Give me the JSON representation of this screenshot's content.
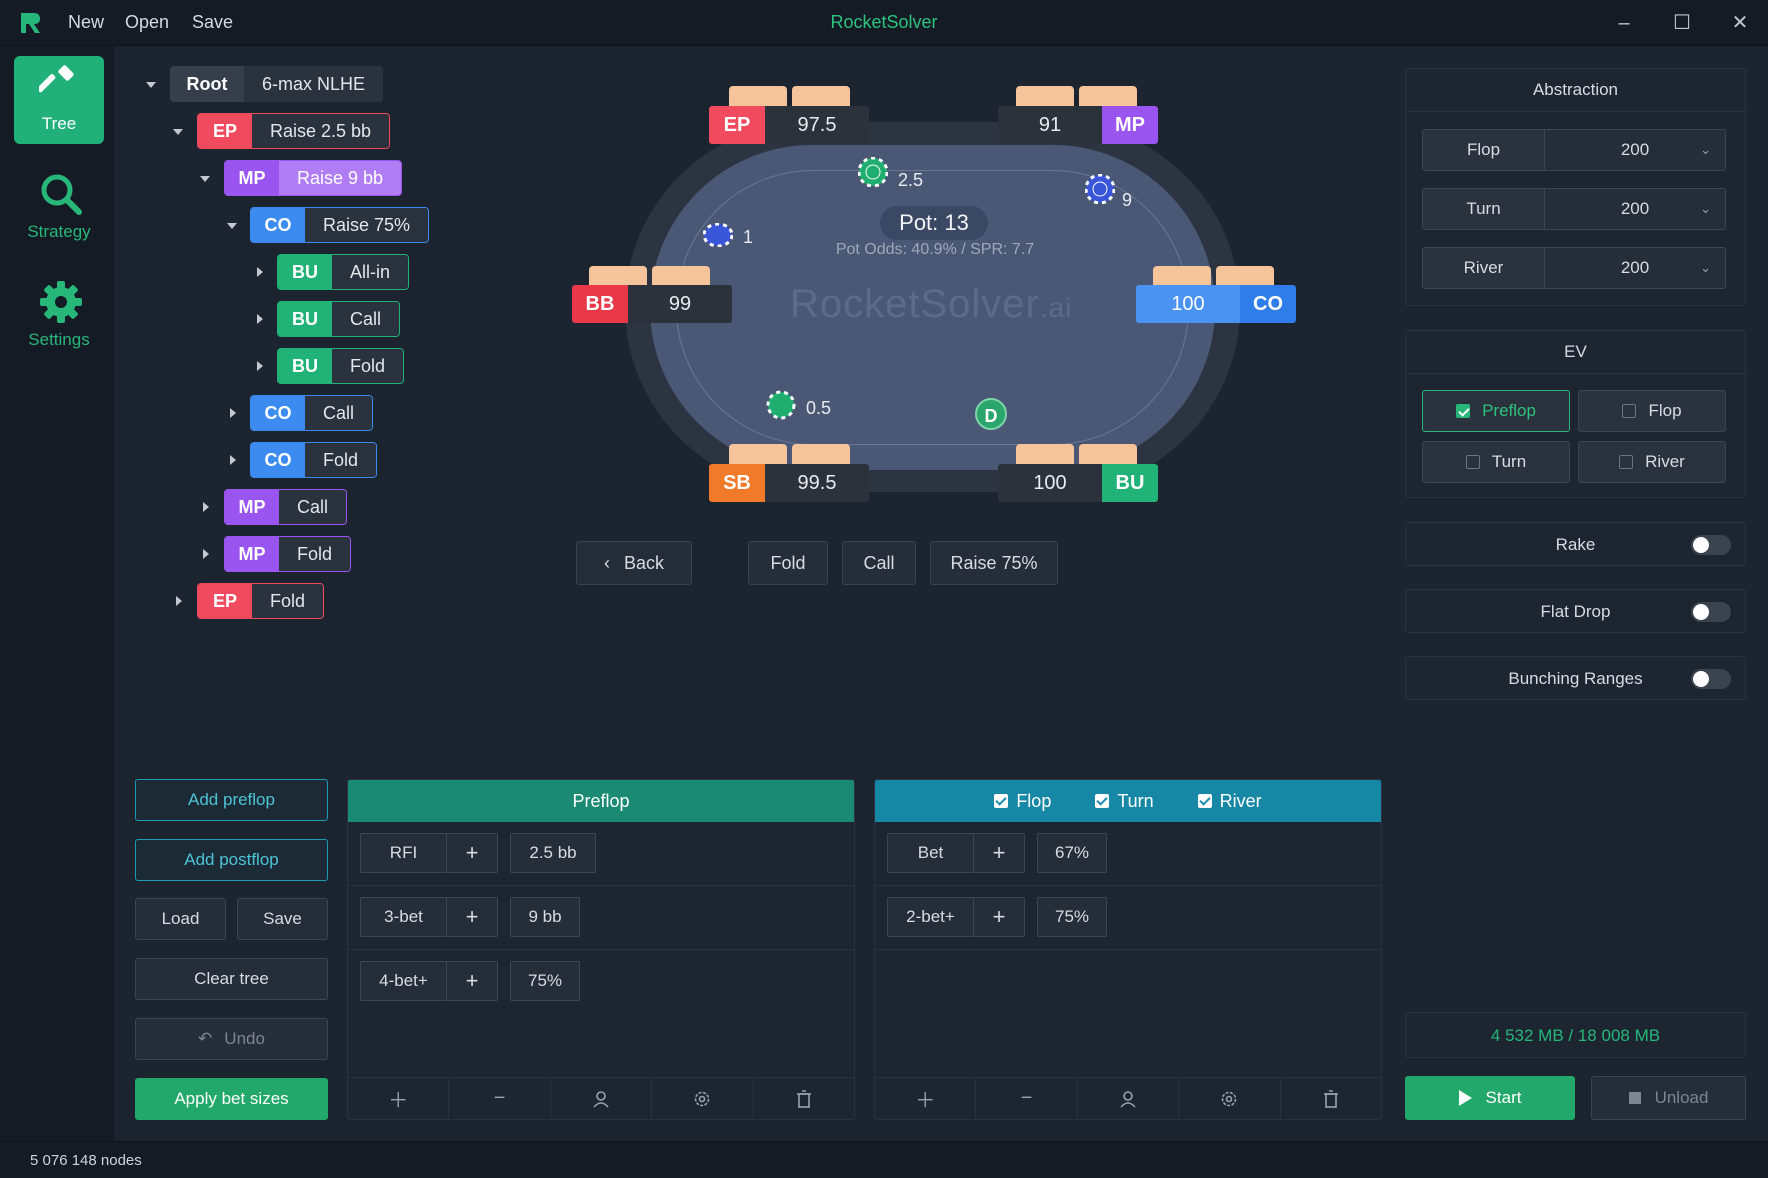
{
  "window": {
    "title": "RocketSolver",
    "menu": [
      "New",
      "Open",
      "Save"
    ]
  },
  "sidebar": {
    "items": [
      {
        "label": "Tree",
        "icon": "hammer-icon",
        "active": true
      },
      {
        "label": "Strategy",
        "icon": "search-icon"
      },
      {
        "label": "Settings",
        "icon": "gear-icon"
      }
    ]
  },
  "tree": {
    "root": {
      "label": "Root",
      "game": "6-max NLHE"
    },
    "nodes": [
      {
        "pos": "EP",
        "action": "Raise 2.5 bb",
        "color": "#f04a5e"
      },
      {
        "pos": "MP",
        "action": "Raise 9 bb",
        "color": "#9a55f0"
      },
      {
        "pos": "CO",
        "action": "Raise 75%",
        "color": "#3c8bf0"
      },
      {
        "pos": "BU",
        "action": "All-in",
        "color": "#21b277"
      },
      {
        "pos": "BU",
        "action": "Call",
        "color": "#21b277"
      },
      {
        "pos": "BU",
        "action": "Fold",
        "color": "#21b277"
      },
      {
        "pos": "CO",
        "action": "Call",
        "color": "#3c8bf0"
      },
      {
        "pos": "CO",
        "action": "Fold",
        "color": "#3c8bf0"
      },
      {
        "pos": "MP",
        "action": "Call",
        "color": "#9a55f0"
      },
      {
        "pos": "MP",
        "action": "Fold",
        "color": "#9a55f0"
      },
      {
        "pos": "EP",
        "action": "Fold",
        "color": "#f04a5e"
      }
    ]
  },
  "table": {
    "pot_label": "Pot: 13",
    "odds_label": "Pot Odds: 40.9%  /  SPR: 7.7",
    "watermark": "RocketSolver",
    "watermark_suffix": ".ai",
    "dealer": "D",
    "seats": {
      "ep": {
        "pos": "EP",
        "stack": "97.5",
        "color": "#f04a5e"
      },
      "mp": {
        "pos": "MP",
        "stack": "91",
        "color": "#9a55f0"
      },
      "bb": {
        "pos": "BB",
        "stack": "99",
        "color": "#e8384a"
      },
      "co": {
        "pos": "CO",
        "stack": "100",
        "color": "#3c8bf0"
      },
      "sb": {
        "pos": "SB",
        "stack": "99.5",
        "color": "#f07a2a"
      },
      "bu": {
        "pos": "BU",
        "stack": "100",
        "color": "#21b277"
      }
    },
    "chips": {
      "ep": "2.5",
      "mp": "9",
      "bb": "1",
      "sb": "0.5"
    }
  },
  "actions": {
    "back": "Back",
    "fold": "Fold",
    "call": "Call",
    "raise": "Raise 75%"
  },
  "abstraction": {
    "title": "Abstraction",
    "rows": [
      {
        "street": "Flop",
        "value": "200"
      },
      {
        "street": "Turn",
        "value": "200"
      },
      {
        "street": "River",
        "value": "200"
      }
    ]
  },
  "ev": {
    "title": "EV",
    "preflop": "Preflop",
    "flop": "Flop",
    "turn": "Turn",
    "river": "River"
  },
  "toggles": {
    "rake": "Rake",
    "flat_drop": "Flat Drop",
    "bunching": "Bunching Ranges"
  },
  "left_buttons": {
    "add_preflop": "Add preflop",
    "add_postflop": "Add postflop",
    "load": "Load",
    "save": "Save",
    "clear": "Clear tree",
    "undo": "Undo",
    "apply": "Apply bet sizes"
  },
  "preflop_panel": {
    "title": "Preflop",
    "rows": [
      {
        "name": "RFI",
        "size": "2.5 bb"
      },
      {
        "name": "3-bet",
        "size": "9 bb"
      },
      {
        "name": "4-bet+",
        "size": "75%"
      }
    ]
  },
  "postflop_panel": {
    "flop": "Flop",
    "turn": "Turn",
    "river": "River",
    "rows": [
      {
        "name": "Bet",
        "size": "67%"
      },
      {
        "name": "2-bet+",
        "size": "75%"
      }
    ]
  },
  "plus": "+",
  "memory": "4 532 MB / 18 008 MB",
  "start": "Start",
  "unload": "Unload",
  "status": "5 076 148 nodes",
  "colors": {
    "accent": "#22b07a",
    "teal_header": "#1a8a73",
    "blue_header": "#1787a6"
  }
}
